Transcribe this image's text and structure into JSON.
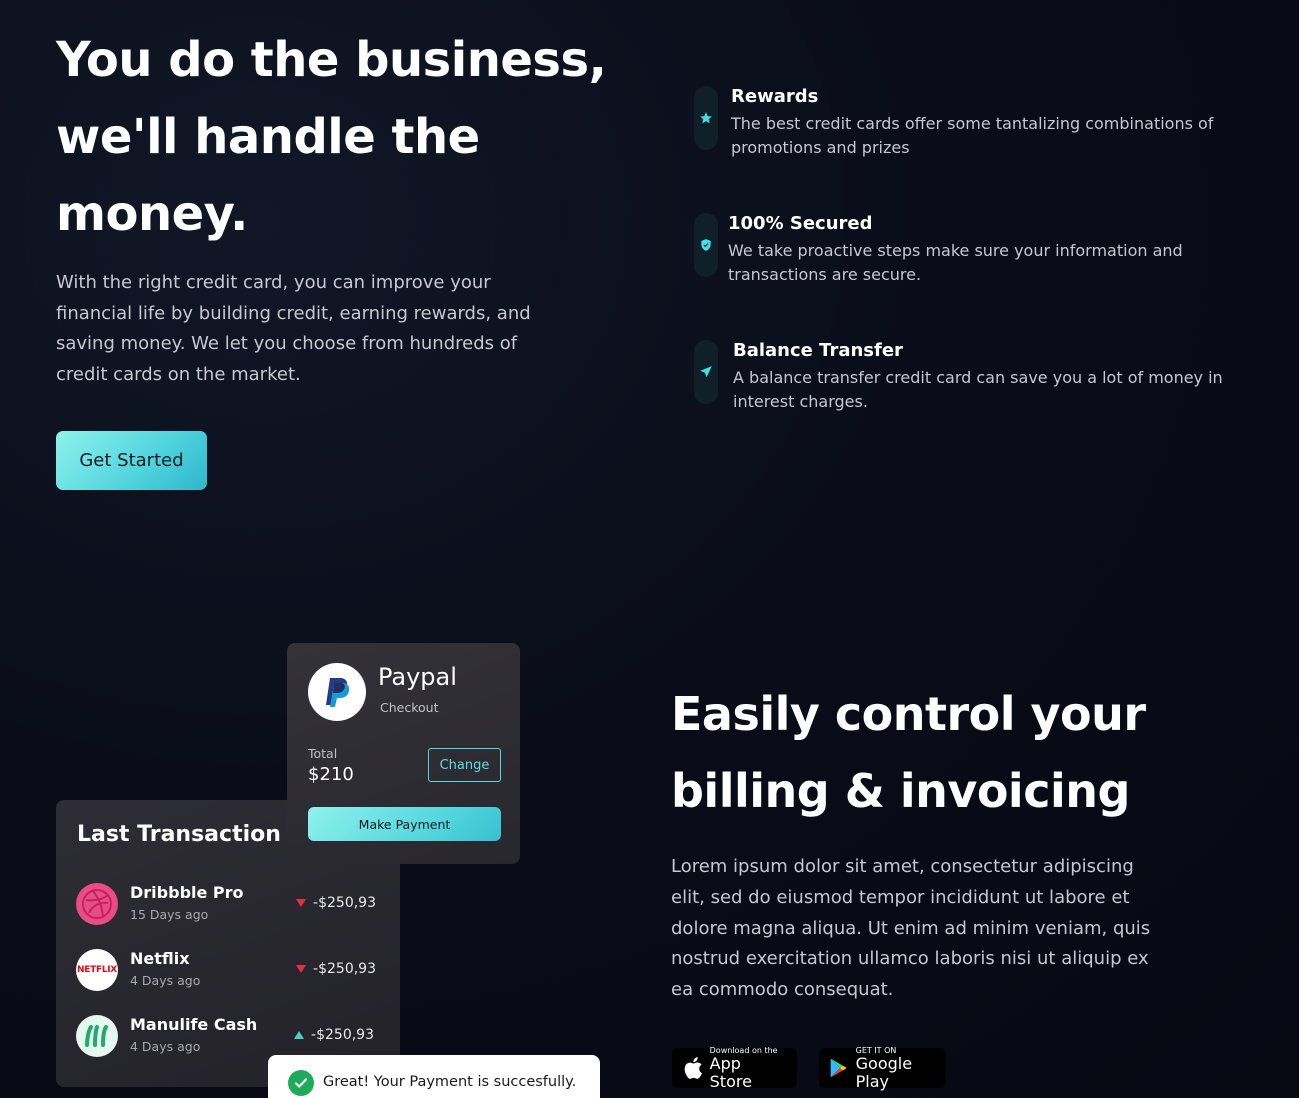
{
  "hero": {
    "title": "You do the business, we'll handle the money.",
    "description": "With the right credit card, you can improve your financial life by building credit, earning rewards, and saving money. We let you choose from hundreds of credit cards on the market.",
    "cta_label": "Get Started"
  },
  "features": [
    {
      "icon": "star-icon",
      "title": "Rewards",
      "description": "The best credit cards offer some tantalizing combinations of promotions and prizes"
    },
    {
      "icon": "shield-icon",
      "title": "100% Secured",
      "description": "We take proactive steps make sure your information and transactions are secure."
    },
    {
      "icon": "send-icon",
      "title": "Balance Transfer",
      "description": "A balance transfer credit card can save you a lot of money in interest charges."
    }
  ],
  "transactions": {
    "title": "Last Transaction",
    "items": [
      {
        "name": "Dribbble Pro",
        "date": "15 Days ago",
        "amount": "-$250,93",
        "trend": "down"
      },
      {
        "name": "Netflix",
        "date": "4 Days ago",
        "amount": "-$250,93",
        "trend": "down"
      },
      {
        "name": "Manulife Cash",
        "date": "4 Days ago",
        "amount": "-$250,93",
        "trend": "up"
      }
    ]
  },
  "paypal": {
    "name": "Paypal",
    "subtitle": "Checkout",
    "total_label": "Total",
    "total": "$210",
    "change_label": "Change",
    "pay_label": "Make Payment"
  },
  "toast": {
    "message": "Great! Your Payment is succesfully."
  },
  "billing": {
    "title": "Easily control your billing & invoicing",
    "description": "Lorem ipsum dolor sit amet, consectetur adipiscing elit, sed do eiusmod tempor incididunt ut labore et dolore magna aliqua. Ut enim ad minim veniam, quis nostrud exercitation ullamco laboris nisi ut aliquip ex ea commodo consequat."
  },
  "stores": {
    "appstore_small": "Download on the",
    "appstore_big": "App Store",
    "googleplay_small": "GET IT ON",
    "googleplay_big": "Google Play"
  },
  "colors": {
    "accent": "#4fd3dc",
    "background": "#0a0d19",
    "down": "#e0313f",
    "up": "#3fd2c7"
  }
}
